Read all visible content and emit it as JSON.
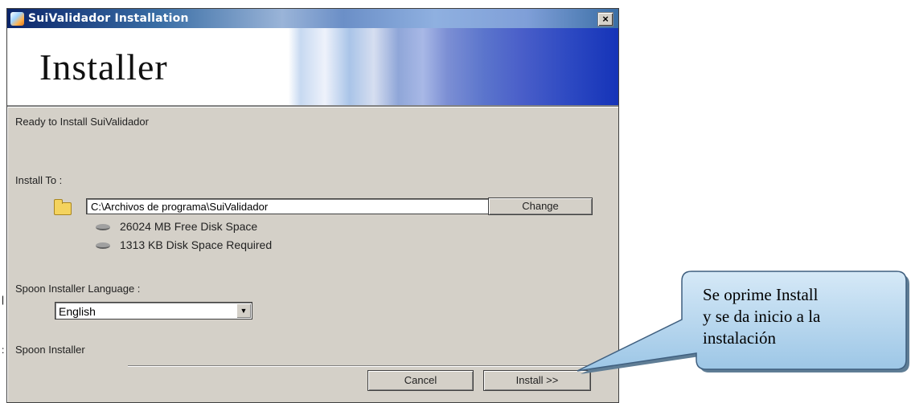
{
  "window": {
    "title": "SuiValidador Installation",
    "close_label": "×"
  },
  "banner": {
    "title": "Installer"
  },
  "main": {
    "ready_text": "Ready to Install SuiValidador",
    "install_to_label": "Install To :",
    "install_path": "C:\\Archivos de programa\\SuiValidador",
    "change_label": "Change",
    "free_space": "26024 MB Free Disk Space",
    "required_space": "1313 KB Disk Space Required",
    "language_label": "Spoon Installer Language :",
    "language_value": "English",
    "footer_brand": "Spoon Installer"
  },
  "buttons": {
    "cancel_label": "Cancel",
    "install_label": "Install >>"
  },
  "callout": {
    "lines": [
      "Se oprime Install",
      "y se da inicio a la",
      "instalación"
    ]
  },
  "icons": {
    "folder": "folder-icon",
    "disk": "disk-icon",
    "app": "installer-app-icon",
    "dropdown": "chevron-down-icon"
  },
  "colors": {
    "dialog_bg": "#d4d0c8",
    "callout_fill": "#b7d6ee"
  }
}
